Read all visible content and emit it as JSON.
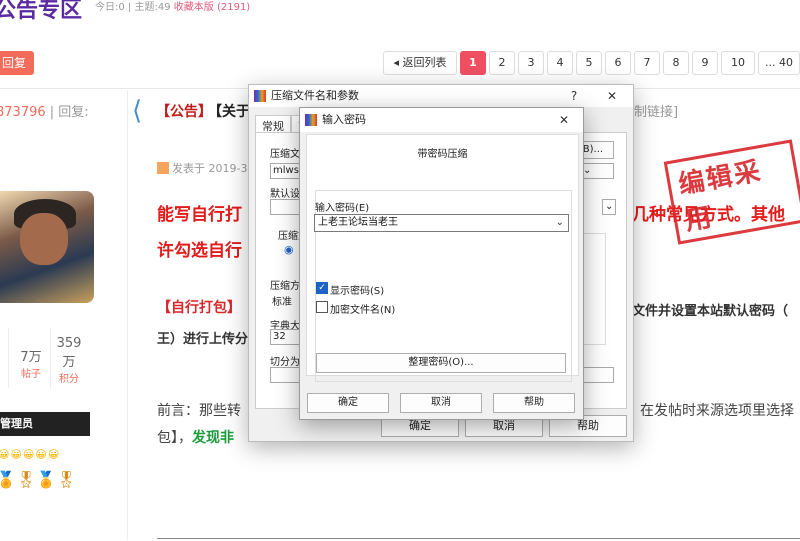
{
  "forum": {
    "title": "公告专区",
    "today": "今日:0",
    "topics": "主题:49",
    "favorite": "收藏本版",
    "favorite_count": "(2191)",
    "reply_button": "回复",
    "back_list": "返回列表",
    "pages": [
      "1",
      "2",
      "3",
      "4",
      "5",
      "6",
      "7",
      "8",
      "9",
      "10",
      "... 40"
    ],
    "left_stats": "873796",
    "left_reply": "回复:",
    "notice_tag": "【公告】",
    "notice_title": "【关于",
    "notice_tail": "制链接]",
    "post_meta": "发表于 2019-3-2",
    "red_line1_left": "能写自行打",
    "red_line1_right": "几种常见方式。其他",
    "red_line2": "许勾选自行",
    "stamp": "编辑采用",
    "zibao": "【自行打包】",
    "body_line_right": "文件并设置本站默认密码（",
    "body_line2": "王）进行上传分",
    "user_posts": "7万",
    "user_posts_label": "帖子",
    "user_points": "359万",
    "user_points_label": "积分",
    "admin_badge": "管理员",
    "qianyan": "前言：那些转",
    "qianyan_right": "在发帖时来源选项里选择",
    "bao_left": "包】，",
    "bao_green": "发现非"
  },
  "dialog_back": {
    "title": "压缩文件名和参数",
    "help": "?",
    "close": "✕",
    "tab_general": "常规",
    "tab_advanced": "高",
    "archive_name_label": "压缩文件",
    "archive_name_value": "mlwsm",
    "browse_button": "(B)...",
    "default_settings_label": "默认设置",
    "format_label": "压缩文",
    "method_label": "压缩方式",
    "method_value": "标准",
    "dict_label": "字典大小",
    "dict_value": "32",
    "split_label": "切分为分",
    "ok": "确定",
    "cancel": "取消",
    "help_button": "帮助"
  },
  "dialog_password": {
    "title": "输入密码",
    "close": "✕",
    "heading": "带密码压缩",
    "password_label": "输入密码(E)",
    "password_value": "上老王论坛当老王",
    "show_password_label": "显示密码(S)",
    "show_password_checked": true,
    "encrypt_names_label": "加密文件名(N)",
    "encrypt_names_checked": false,
    "organize_button": "整理密码(O)...",
    "ok": "确定",
    "cancel": "取消",
    "help": "帮助"
  },
  "colors": {
    "accent_red": "#f04f62",
    "forum_purple": "#5a2aa0",
    "checkbox_blue": "#1e64c8"
  }
}
